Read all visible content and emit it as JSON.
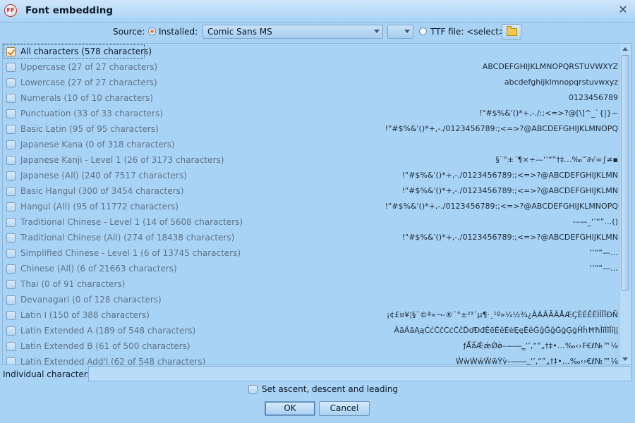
{
  "window": {
    "title": "Font embedding",
    "app_icon_text": "FF"
  },
  "source": {
    "label": "Source:",
    "installed_label": "Installed:",
    "font_value": "Comic Sans MS",
    "ttf_label": "TTF file: <select>",
    "selected_option": "installed"
  },
  "charsets": [
    {
      "label": "All characters (578 characters)",
      "sample": "",
      "checked": true
    },
    {
      "label": "Uppercase (27 of 27 characters)",
      "sample": "ABCDEFGHIJKLMNOPQRSTUVWXYZ",
      "checked": false
    },
    {
      "label": "Lowercase (27 of 27 characters)",
      "sample": "abcdefghijklmnopqrstuvwxyz",
      "checked": false
    },
    {
      "label": "Numerals (10 of 10 characters)",
      "sample": "0123456789",
      "checked": false
    },
    {
      "label": "Punctuation (33 of 33 characters)",
      "sample": "!\"#$%&'()*+,-./:;<=>?@[\\]^_`{|}~",
      "checked": false
    },
    {
      "label": "Basic Latin (95 of 95 characters)",
      "sample": "!\"#$%&'()*+,-./0123456789:;<=>?@ABCDEFGHIJKLMNOPQ",
      "checked": false
    },
    {
      "label": "Japanese Kana (0 of 318 characters)",
      "sample": "",
      "checked": false
    },
    {
      "label": "Japanese Kanji - Level 1 (26 of 3173 characters)",
      "sample": "§¨°±´¶×÷—‘’“”†‡…‰′″∂√∞∫≠▪",
      "checked": false
    },
    {
      "label": "Japanese (All) (240 of 7517 characters)",
      "sample": "!\"#$%&'()*+,-./0123456789:;<=>?@ABCDEFGHIJKLMN",
      "checked": false
    },
    {
      "label": "Basic Hangul (300 of 3454 characters)",
      "sample": "!\"#$%&'()*+,-./0123456789:;<=>?@ABCDEFGHIJKLMN",
      "checked": false
    },
    {
      "label": "Hangul (All) (95 of 11772 characters)",
      "sample": "!\"#$%&'()*+,-./0123456789:;<=>?@ABCDEFGHIJKLMNOPQ",
      "checked": false
    },
    {
      "label": "Traditional Chinese - Level 1 (14 of 5608 characters)",
      "sample": "-–—_‘’“”…()",
      "checked": false
    },
    {
      "label": "Traditional Chinese (All) (274 of 18438 characters)",
      "sample": "!\"#$%&'()*+,-./0123456789:;<=>?@ABCDEFGHIJKLMN",
      "checked": false
    },
    {
      "label": "Simplified Chinese - Level 1 (6 of 13745 characters)",
      "sample": "‘’“”—…",
      "checked": false
    },
    {
      "label": "Chinese (All) (6 of 21663 characters)",
      "sample": "‘’“”—…",
      "checked": false
    },
    {
      "label": "Thai (0 of 91 characters)",
      "sample": "",
      "checked": false
    },
    {
      "label": "Devanagari (0 of 128 characters)",
      "sample": "",
      "checked": false
    },
    {
      "label": "Latin I (150 of 388 characters)",
      "sample": "¡¢£¤¥¦§¨©ª«¬-®¯°±²³´µ¶·¸¹º»¼½¾¿ÀÁÂÃÄÅÆÇÈÉÊËÌÍÎÏÐÑ",
      "checked": false
    },
    {
      "label": "Latin Extended A (189 of 548 characters)",
      "sample": "ĀāĂăĄąĆćĈĉĊċČčĎďĐđĒēĔĕĖėĘęĚěĜĝĞğĠġĢģĤĥĦħĨĩĪīĬĭĮį",
      "checked": false
    },
    {
      "label": "Latin Extended B (61 of 500 characters)",
      "sample": "ƒǺǻǼǽǾǿ–—―‗‘’‚“”„†‡•…‰‹›₣€ℓ№™⅛",
      "checked": false
    },
    {
      "label": "Latin Extended Add'l (62 of 548 characters)",
      "sample": "ẀẁẂẃẄẅỲỳ–—―‗‘’‚“”„†‡•…‰‹›€ℓ№™⅛",
      "checked": false
    }
  ],
  "individual": {
    "label": "Individual characters:",
    "value": ""
  },
  "ascent": {
    "label": "Set ascent, descent and leading",
    "checked": false
  },
  "buttons": {
    "ok": "OK",
    "cancel": "Cancel"
  },
  "colors": {
    "background": "#a9d3f5",
    "accent": "#e6812b"
  }
}
